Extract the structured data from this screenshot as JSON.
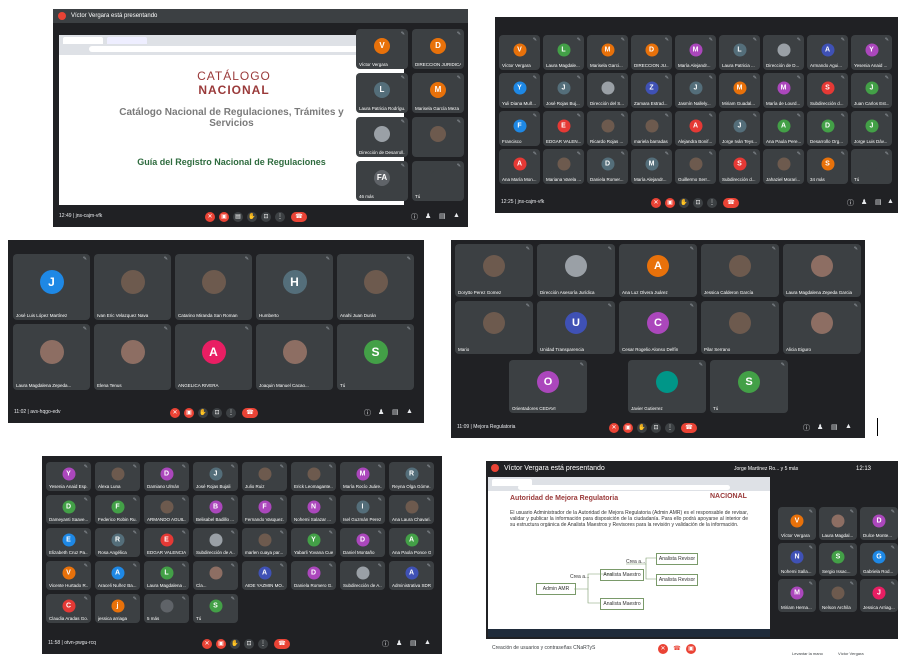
{
  "shot1": {
    "banner": "Víctor Vergara está presentando",
    "slide": {
      "logo_top": "CATÁLOGO",
      "logo_bottom": "NACIONAL",
      "title": "Catálogo Nacional de Regulaciones, Trámites y Servicios",
      "subtitle": "Guía del Registro Nacional de Regulaciones"
    },
    "tiles": [
      {
        "initial": "V",
        "name": "Víctor Vergara",
        "color": "#e8710a"
      },
      {
        "initial": "D",
        "name": "DIRECCION JURIDICA",
        "color": "#e8710a"
      },
      {
        "initial": "L",
        "name": "Laura Patricia Rodrígu...",
        "color": "#546e7a"
      },
      {
        "initial": "M",
        "name": "Marisela García Meza",
        "color": "#e8710a"
      },
      {
        "initial": "",
        "name": "Dirección de Desarroll...",
        "color": "#9aa0a6"
      },
      {
        "initial": "",
        "name": "",
        "color": "#6d5a4e"
      },
      {
        "initial": "FA",
        "name": "46 más",
        "color": "#5f6368"
      },
      {
        "initial": "",
        "name": "Tú",
        "color": "#3c4043"
      }
    ],
    "meeting": "12:49 | jns-cajm-vfk"
  },
  "shot2": {
    "tiles": [
      {
        "initial": "V",
        "name": "Víctor Vergara",
        "color": "#e8710a"
      },
      {
        "initial": "L",
        "name": "Laura Magdale...",
        "color": "#43a047"
      },
      {
        "initial": "M",
        "name": "Marisela Garci...",
        "color": "#e8710a"
      },
      {
        "initial": "D",
        "name": "DIRECCION JU...",
        "color": "#e8710a"
      },
      {
        "initial": "M",
        "name": "María Alejandr...",
        "color": "#ab47bc"
      },
      {
        "initial": "L",
        "name": "Laura Patricia ...",
        "color": "#546e7a"
      },
      {
        "initial": "",
        "name": "Dirección de D...",
        "color": "#9aa0a6"
      },
      {
        "initial": "A",
        "name": "Armando Agui...",
        "color": "#3f51b5"
      },
      {
        "initial": "Y",
        "name": "Yesenia Anaid ...",
        "color": "#ab47bc"
      },
      {
        "initial": "Y",
        "name": "Yuli Diana Muñ...",
        "color": "#1e88e5"
      },
      {
        "initial": "J",
        "name": "José Rojas Buj...",
        "color": "#546e7a"
      },
      {
        "initial": "",
        "name": "Dirección del S...",
        "color": "#9aa0a6"
      },
      {
        "initial": "Z",
        "name": "Zamara Estrad...",
        "color": "#3f51b5"
      },
      {
        "initial": "J",
        "name": "Jasmín Nallely...",
        "color": "#546e7a"
      },
      {
        "initial": "M",
        "name": "Miriam Guadal...",
        "color": "#e8710a"
      },
      {
        "initial": "M",
        "name": "María de Lourd...",
        "color": "#ab47bc"
      },
      {
        "initial": "S",
        "name": "Subdirección d...",
        "color": "#e53935"
      },
      {
        "initial": "J",
        "name": "Juan Carlos Est...",
        "color": "#43a047"
      },
      {
        "initial": "F",
        "name": "Francisco",
        "color": "#1e88e5"
      },
      {
        "initial": "E",
        "name": "EDGAR VALEN...",
        "color": "#e53935"
      },
      {
        "initial": "",
        "name": "Ricardo Rojas ...",
        "color": "#6d5a4e"
      },
      {
        "initial": "",
        "name": "mariela barradas",
        "color": "#6d5a4e"
      },
      {
        "initial": "A",
        "name": "Alejandra Bonif...",
        "color": "#e53935"
      },
      {
        "initial": "J",
        "name": "Jorge Iván Teys...",
        "color": "#546e7a"
      },
      {
        "initial": "A",
        "name": "Ana Paula Pere...",
        "color": "#43a047"
      },
      {
        "initial": "D",
        "name": "Desarrollo Org...",
        "color": "#43a047"
      },
      {
        "initial": "J",
        "name": "Jorge Luis Dáv...",
        "color": "#43a047"
      },
      {
        "initial": "A",
        "name": "Ana María Mon...",
        "color": "#e53935"
      },
      {
        "initial": "",
        "name": "Mariana Varela ...",
        "color": "#6d5a4e"
      },
      {
        "initial": "D",
        "name": "Daniela Romer...",
        "color": "#546e7a"
      },
      {
        "initial": "M",
        "name": "María Alejandr...",
        "color": "#546e7a"
      },
      {
        "initial": "",
        "name": "Guillermo Serr...",
        "color": "#6d5a4e"
      },
      {
        "initial": "S",
        "name": "Subdirección d...",
        "color": "#e53935"
      },
      {
        "initial": "",
        "name": "Jahaziel Morari...",
        "color": "#6d5a4e"
      },
      {
        "initial": "S",
        "name": "34 más",
        "color": "#e8710a"
      },
      {
        "initial": "",
        "name": "Tú",
        "color": "#3c4043"
      }
    ],
    "meeting": "12:25 | jns-cajm-vfk"
  },
  "shot3": {
    "tiles": [
      {
        "initial": "J",
        "name": "José Luis López Martínez",
        "color": "#1e88e5"
      },
      {
        "initial": "",
        "name": "Ivan Eric Velazquez Nava",
        "color": "#6d5a4e"
      },
      {
        "initial": "",
        "name": "Catarino Miranda San Roman",
        "color": "#6d5a4e"
      },
      {
        "initial": "H",
        "name": "Humberto",
        "color": "#546e7a"
      },
      {
        "initial": "",
        "name": "Anahi Juan Durán",
        "color": "#6d5a4e"
      },
      {
        "initial": "",
        "name": "Laura Magdalena Zepeda...",
        "color": "#8d6e63"
      },
      {
        "initial": "",
        "name": "Elena Tenus",
        "color": "#8d6e63"
      },
      {
        "initial": "A",
        "name": "ANGELICA RIVERA",
        "color": "#e91e63"
      },
      {
        "initial": "",
        "name": "Joaquin Manuel Cacao...",
        "color": "#8d6e63"
      },
      {
        "initial": "S",
        "name": "Tú",
        "color": "#43a047"
      }
    ],
    "meeting": "11:02 | avs-hqgo-edv"
  },
  "shot4": {
    "tiles": [
      {
        "initial": "",
        "name": "Dorytto Perez Gomez",
        "color": "#6d5a4e"
      },
      {
        "initial": "",
        "name": "Dirección Asesoría Jurídica",
        "color": "#9aa0a6"
      },
      {
        "initial": "A",
        "name": "Ana Luz Olvera Juárez",
        "color": "#e8710a"
      },
      {
        "initial": "",
        "name": "Jessica Calderon García",
        "color": "#6d5a4e"
      },
      {
        "initial": "",
        "name": "Laura Magdalena Zepeda Garcia",
        "color": "#8d6e63"
      },
      {
        "initial": "",
        "name": "Mario",
        "color": "#6d5a4e"
      },
      {
        "initial": "U",
        "name": "Unidad Transparencia",
        "color": "#3f51b5"
      },
      {
        "initial": "C",
        "name": "Cesar Rogelio Alonso Delfín",
        "color": "#ab47bc"
      },
      {
        "initial": "",
        "name": "Pilar Serrano",
        "color": "#6d5a4e"
      },
      {
        "initial": "",
        "name": "Alicia Eiguro",
        "color": "#8d6e63"
      },
      {
        "initial": "O",
        "name": "Orientadores CEDAVI",
        "color": "#ab47bc"
      },
      {
        "initial": "",
        "name": "Javier Gutierrez",
        "color": "#009688"
      },
      {
        "initial": "S",
        "name": "Tú",
        "color": "#43a047"
      }
    ],
    "meeting": "11:09 | Mejora Regulatoria"
  },
  "shot5": {
    "tiles": [
      {
        "initial": "Y",
        "name": "Yesenia Anaid Esp...",
        "color": "#ab47bc"
      },
      {
        "initial": "",
        "name": "Alexa Luna",
        "color": "#6d5a4e"
      },
      {
        "initial": "D",
        "name": "Damiano Ulmán",
        "color": "#ab47bc"
      },
      {
        "initial": "J",
        "name": "José Rojas Bujali",
        "color": "#546e7a"
      },
      {
        "initial": "",
        "name": "Julio Ruiz",
        "color": "#6d5a4e"
      },
      {
        "initial": "",
        "name": "Erick Leomagante...",
        "color": "#6d5a4e"
      },
      {
        "initial": "M",
        "name": "María Rocío Juáre...",
        "color": "#ab47bc"
      },
      {
        "initial": "R",
        "name": "Reyna Olga Góme...",
        "color": "#546e7a"
      },
      {
        "initial": "D",
        "name": "Dameyanti Saave...",
        "color": "#43a047"
      },
      {
        "initial": "F",
        "name": "Federico Robin Ru...",
        "color": "#43a047"
      },
      {
        "initial": "",
        "name": "ARMANDO AGUIL...",
        "color": "#6d5a4e"
      },
      {
        "initial": "B",
        "name": "Belisabel Badillo ...",
        "color": "#ab47bc"
      },
      {
        "initial": "F",
        "name": "Fernando Vasquez...",
        "color": "#ab47bc"
      },
      {
        "initial": "N",
        "name": "Nohemi Salazar ...",
        "color": "#ab47bc"
      },
      {
        "initial": "I",
        "name": "Isel Guzmán Perez",
        "color": "#546e7a"
      },
      {
        "initial": "",
        "name": "Ana Laura Chavari...",
        "color": "#6d5a4e"
      },
      {
        "initial": "E",
        "name": "Elizabeth Cruz Pa...",
        "color": "#1e88e5"
      },
      {
        "initial": "R",
        "name": "Rosa Angélica",
        "color": "#546e7a"
      },
      {
        "initial": "E",
        "name": "EDGAR VALENCIA...",
        "color": "#e53935"
      },
      {
        "initial": "",
        "name": "Subdirección de A...",
        "color": "#9aa0a6"
      },
      {
        "initial": "",
        "name": "marlen cuaya par...",
        "color": "#6d5a4e"
      },
      {
        "initial": "Y",
        "name": "Yabarli Yovana Cue...",
        "color": "#43a047"
      },
      {
        "initial": "D",
        "name": "Daniel Montaño",
        "color": "#ab47bc"
      },
      {
        "initial": "A",
        "name": "Ana Paola Ponce G...",
        "color": "#43a047"
      },
      {
        "initial": "V",
        "name": "Vicente Hurtado R...",
        "color": "#e8710a"
      },
      {
        "initial": "A",
        "name": "Araceli Nuñez Ba...",
        "color": "#1e88e5"
      },
      {
        "initial": "L",
        "name": "Laura Magdalena ...",
        "color": "#43a047"
      },
      {
        "initial": "",
        "name": "Cla...",
        "color": "#8d6e63"
      },
      {
        "initial": "A",
        "name": "AIDE YAZMIN MO...",
        "color": "#3f51b5"
      },
      {
        "initial": "D",
        "name": "Daniela Romero G...",
        "color": "#ab47bc"
      },
      {
        "initial": "",
        "name": "Subdirección de A...",
        "color": "#9aa0a6"
      },
      {
        "initial": "A",
        "name": "Administrativa SDR",
        "color": "#3f51b5"
      },
      {
        "initial": "C",
        "name": "Claudia Aradas Go...",
        "color": "#e53935"
      },
      {
        "initial": "j",
        "name": "jessica arriaga",
        "color": "#e8710a"
      },
      {
        "initial": "",
        "name": "5 más",
        "color": "#5f6368"
      },
      {
        "initial": "S",
        "name": "Tú",
        "color": "#43a047"
      }
    ],
    "meeting": "11:58 | otvn-pwgu-rcq"
  },
  "shot6": {
    "banner": "Víctor Vergara está presentando",
    "presenter_chip": "Jorge Martínez Ro... y 5 más",
    "clock": "12:13",
    "slide": {
      "header": "Autoridad de Mejora Regulatoria",
      "logo": "NACIONAL",
      "body": "El usuario Administrador de la Autoridad de Mejora Regulatoria (Admin AMR) es el responsable de revisar, validar y publicar la información para disposición de la ciudadanía. Para ello podrá apoyarse al interior de su estructura orgánica de Analista Maestros y Revisores para la revisión y validación de la información.",
      "diagram": {
        "admin": "Admin AMR",
        "crea1": "Crea a...",
        "crea2": "Crea a...",
        "maestro": "Analista Maestro",
        "rev1": "Analista Revisor",
        "rev2": "Analista Revisor",
        "maestro2": "Analista Maestro"
      }
    },
    "tiles": [
      {
        "initial": "V",
        "name": "Víctor Vergara",
        "color": "#e8710a"
      },
      {
        "initial": "",
        "name": "Laura Magdal...",
        "color": "#8d6e63"
      },
      {
        "initial": "D",
        "name": "Dulce Monte...",
        "color": "#ab47bc"
      },
      {
        "initial": "N",
        "name": "Nohemi Salla...",
        "color": "#3f51b5"
      },
      {
        "initial": "S",
        "name": "Sergio Issac...",
        "color": "#43a047"
      },
      {
        "initial": "G",
        "name": "Gabriela Rod...",
        "color": "#1e88e5"
      },
      {
        "initial": "M",
        "name": "Miriam Herna...",
        "color": "#ab47bc"
      },
      {
        "initial": "",
        "name": "Nelson Archila",
        "color": "#6d5a4e"
      },
      {
        "initial": "J",
        "name": "Jessica Arriag...",
        "color": "#e91e63"
      }
    ],
    "footer": "Creación de usuarios y contraseñas CNaRTyS",
    "raise_hand": "Levantar la mano",
    "presenter_footer": "Víctor Vergara"
  }
}
